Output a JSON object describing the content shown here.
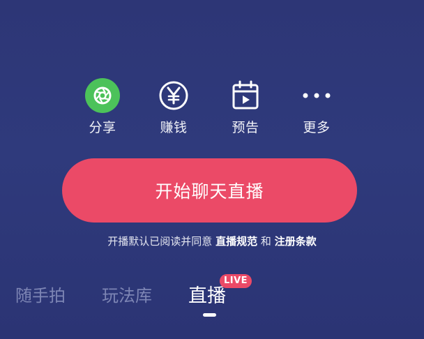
{
  "actions": {
    "share": {
      "label": "分享",
      "icon": "shutter-icon",
      "color": "#4cc25a"
    },
    "earn": {
      "label": "赚钱",
      "icon": "yen-circle-icon"
    },
    "preview": {
      "label": "预告",
      "icon": "calendar-play-icon"
    },
    "more": {
      "label": "更多",
      "icon": "more-dots-icon"
    }
  },
  "start_button": {
    "label": "开始聊天直播",
    "color": "#eb4a67"
  },
  "agreement": {
    "prefix": "开播默认已阅读并同意",
    "link1": "直播规范",
    "conjunction": "和",
    "link2": "注册条款"
  },
  "tabs": [
    {
      "label": "随手拍",
      "active": false
    },
    {
      "label": "玩法库",
      "active": false
    },
    {
      "label": "直播",
      "active": true,
      "badge": "LIVE"
    }
  ]
}
